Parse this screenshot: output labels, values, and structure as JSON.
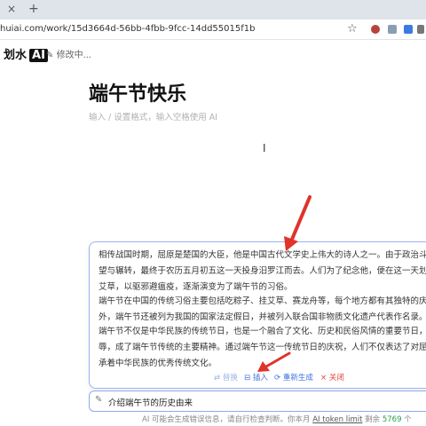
{
  "browser": {
    "tab_close": "×",
    "tab_new": "+",
    "url": "huiai.com/work/15d3664d-56bb-4fbb-9fcc-14dd55015f1b"
  },
  "app": {
    "brand_text": "划水",
    "brand_ai": "AI",
    "status": "修改中..."
  },
  "document": {
    "title": "端午节快乐",
    "placeholder": "输入 / 设置格式，输入空格使用 AI"
  },
  "ai_result": {
    "paragraphs": [
      [
        "相传战国时期，屈原是楚国的大臣，他是中国古代文学史上伟大的诗人之一。由于政治斗争失败，他所",
        "望与辗转，最终于农历五月初五这一天投身汨罗江而去。人们为了纪念他，便在这一天划龙舟、扎篙所",
        "艾草，以驱邪避瘟疫，逐渐演变为了端午节的习俗。"
      ],
      [
        "端午节在中国的传统习俗主要包括吃粽子、挂艾草、赛龙舟等，每个地方都有其独特的庆祝方式。除此",
        "外，端午节还被列为我国的国家法定假日，并被列入联合国非物质文化遗产代表作名录。"
      ],
      [
        "端午节不仅是中华民族的传统节日，也是一个融合了文化、历史和民俗风情的重要节日，而屈原抱石自",
        "辱，成了端午节传统的主要精神。通过端午节这一传统节日的庆祝，人们不仅表达了对屈原的缅怀，也",
        "承着中华民族的优秀传统文化。"
      ]
    ],
    "actions": {
      "replace": "替换",
      "insert": "插入",
      "regenerate": "重新生成",
      "close": "关闭"
    }
  },
  "prompt": {
    "value": "介绍端午节的历史由来"
  },
  "footer": {
    "prefix": "AI 可能会生成错误信息，请自行检查判断。你本月",
    "link": "AI token limit",
    "mid": "剩余",
    "count": "5769",
    "suffix": "个"
  },
  "colors": {
    "accent": "#3d6fe0",
    "danger": "#e0443a",
    "annotation_arrow": "#e0332a"
  }
}
